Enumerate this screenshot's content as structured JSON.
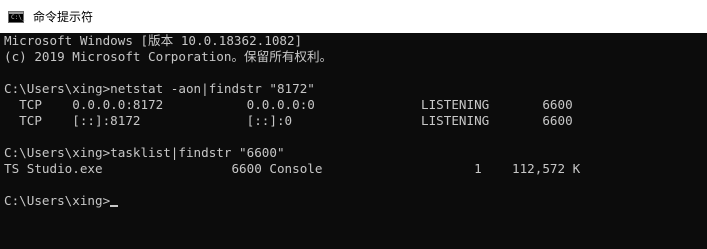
{
  "window": {
    "title": "命令提示符",
    "icon": "cmd-icon",
    "icon_text": "C:\\_"
  },
  "console": {
    "banner_line1": "Microsoft Windows [版本 10.0.18362.1082]",
    "banner_line2": "(c) 2019 Microsoft Corporation。保留所有权利。",
    "command1": "C:\\Users\\xing>netstat -aon|findstr \"8172\"",
    "netstat_rows": [
      "  TCP    0.0.0.0:8172           0.0.0.0:0              LISTENING       6600",
      "  TCP    [::]:8172              [::]:0                 LISTENING       6600"
    ],
    "command2": "C:\\Users\\xing>tasklist|findstr \"6600\"",
    "tasklist_row": "TS Studio.exe                 6600 Console                    1    112,572 K",
    "prompt": "C:\\Users\\xing>"
  }
}
